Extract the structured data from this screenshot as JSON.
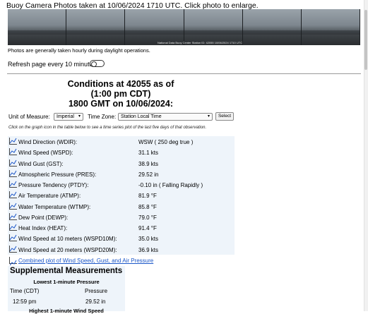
{
  "camera": {
    "caption": "Buoy Camera Photos taken at 10/06/2024 1710 UTC. Click photo to enlarge.",
    "stamp": "National Data Buoy Center Station ID: 42055    10/06/2024 1710 UTC",
    "note": "Photos are generally taken hourly during daylight operations."
  },
  "refresh": {
    "label": "Refresh page every 10 minutes:",
    "enabled": false
  },
  "conditions": {
    "title_line1": "Conditions at 42055 as of",
    "title_line2": "(1:00 pm CDT)",
    "title_line3": "1800 GMT on 10/06/2024:",
    "unit_label": "Unit of Measure:",
    "unit_value": "Imperial",
    "tz_label": "Time Zone:",
    "tz_value": "Station Local Time",
    "select_button": "Select",
    "instruction": "Click on the graph icon in the table below to see a time series plot of the last five days of that observation."
  },
  "observations": [
    {
      "label": "Wind Direction (WDIR):",
      "value": "WSW ( 250 deg true )"
    },
    {
      "label": "Wind Speed (WSPD):",
      "value": "31.1 kts"
    },
    {
      "label": "Wind Gust (GST):",
      "value": "38.9 kts"
    },
    {
      "label": "Atmospheric Pressure (PRES):",
      "value": "29.52 in"
    },
    {
      "label": "Pressure Tendency (PTDY):",
      "value": "-0.10 in ( Falling Rapidly )"
    },
    {
      "label": "Air Temperature (ATMP):",
      "value": "81.9 °F"
    },
    {
      "label": "Water Temperature (WTMP):",
      "value": "85.8 °F"
    },
    {
      "label": "Dew Point (DEWP):",
      "value": "79.0 °F"
    },
    {
      "label": "Heat Index (HEAT):",
      "value": "91.4 °F"
    },
    {
      "label": "Wind Speed at 10 meters (WSPD10M):",
      "value": "35.0 kts"
    },
    {
      "label": "Wind Speed at 20 meters (WSPD20M):",
      "value": "36.9 kts"
    }
  ],
  "combined_plot_link": "Combined plot of Wind Speed, Gust, and Air Pressure",
  "supplemental": {
    "title": "Supplemental Measurements",
    "lowest_heading": "Lowest 1-minute Pressure",
    "col_time": "Time (CDT)",
    "col_pressure": "Pressure",
    "time": "12:59 pm",
    "pressure": "29.52 in",
    "highest_heading": "Highest 1-minute Wind Speed"
  },
  "colors": {
    "link": "#1a56c8",
    "table_bg": "#eef4fa"
  }
}
